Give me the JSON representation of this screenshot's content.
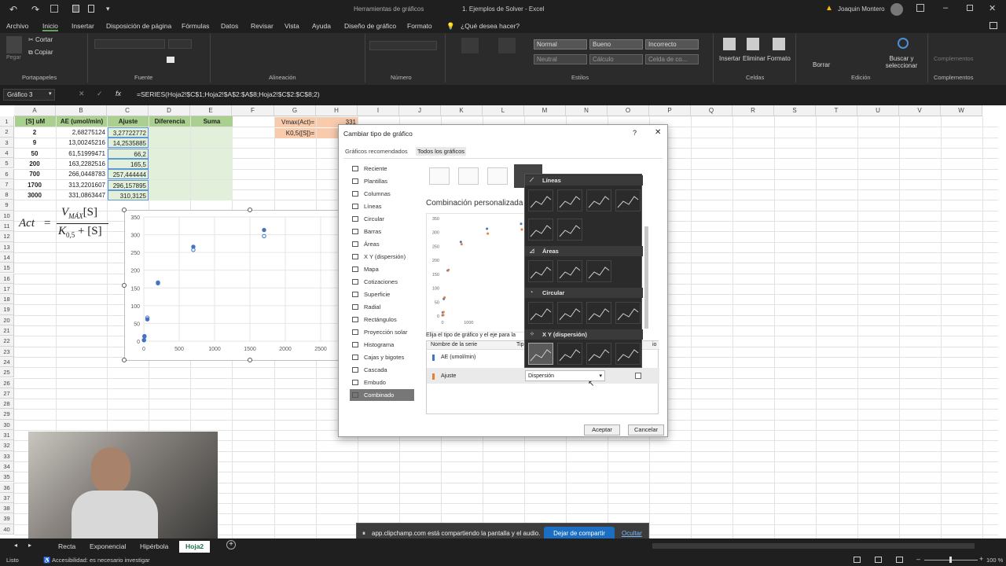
{
  "titlebar": {
    "center_left": "Herramientas de gráficos",
    "doc_title": "1. Ejemplos de Solver  -  Excel",
    "user": "Joaquin Montero"
  },
  "menu": [
    "Archivo",
    "Inicio",
    "Insertar",
    "Disposición de página",
    "Fórmulas",
    "Datos",
    "Revisar",
    "Vista",
    "Ayuda",
    "Diseño de gráfico",
    "Formato"
  ],
  "tell_me": "¿Qué desea hacer?",
  "ribbon": {
    "clipboard": {
      "cut": "Cortar",
      "copy": "Copiar",
      "paste": "Pegar",
      "label": "Portapapeles"
    },
    "font_label": "Fuente",
    "align_label": "Alineación",
    "number_label": "Número",
    "styles_label": "Estilos",
    "cells_label": "Celdas",
    "edit_label": "Edición",
    "addins_label": "Complementos",
    "styles": [
      "Normal",
      "Bueno",
      "Incorrecto",
      "Neutral",
      "Cálculo",
      "Celda de co..."
    ],
    "cells": [
      "Insertar",
      "Eliminar",
      "Formato"
    ],
    "borrar": "Borrar",
    "find": "Buscar y seleccionar",
    "complementos": "Complementos"
  },
  "formula": {
    "namebox": "Gráfico 3",
    "fx": "fx",
    "text": "=SERIES(Hoja2!$C$1;Hoja2!$A$2:$A$8;Hoja2!$C$2:$C$8;2)"
  },
  "columns": [
    "A",
    "B",
    "C",
    "D",
    "E",
    "F",
    "G",
    "H",
    "I",
    "J",
    "K",
    "L",
    "M",
    "N",
    "O",
    "P",
    "Q",
    "R",
    "S",
    "T",
    "U",
    "V",
    "W"
  ],
  "rows": [
    "1",
    "2",
    "3",
    "4",
    "5",
    "6",
    "7",
    "8",
    "9",
    "10",
    "11",
    "12",
    "13",
    "14",
    "15",
    "16",
    "17",
    "18",
    "19",
    "20",
    "21",
    "22",
    "23",
    "24",
    "25",
    "26",
    "27",
    "28",
    "29",
    "30",
    "31",
    "32",
    "33",
    "34",
    "35",
    "36",
    "37",
    "38",
    "39",
    "40"
  ],
  "table": {
    "headers": [
      "[S] uM",
      "AE (umol/min)",
      "Ajuste",
      "Diferencia",
      "Suma"
    ],
    "rows": [
      [
        "2",
        "2,68275124",
        "3,27722772"
      ],
      [
        "9",
        "13,00245216",
        "14,2535885"
      ],
      [
        "50",
        "61,51999471",
        "66,2"
      ],
      [
        "200",
        "163,2282516",
        "165,5"
      ],
      [
        "700",
        "266,0448783",
        "257,444444"
      ],
      [
        "1700",
        "313,2201607",
        "296,157895"
      ],
      [
        "3000",
        "331,0863447",
        "310,3125"
      ]
    ],
    "vmax_label": "Vmax(Act)=",
    "vmax_value": "331",
    "k_label": "K0,5([S])="
  },
  "equation": {
    "lhs": "Act",
    "eq": "=",
    "num": "V",
    "num_sub": "MÁX",
    "num_s": "[S]",
    "den": "K",
    "den_sub": "0,5",
    "den_plus": "+ [S]"
  },
  "chart_data": {
    "type": "scatter",
    "x_ticks": [
      "0",
      "500",
      "1000",
      "1500",
      "2000",
      "2500",
      "3000"
    ],
    "y_ticks": [
      "0",
      "50",
      "100",
      "150",
      "200",
      "250",
      "300",
      "350"
    ],
    "xlim": [
      0,
      3000
    ],
    "ylim": [
      0,
      350
    ],
    "series": [
      {
        "values_x": [
          2,
          9,
          50,
          200,
          700,
          1700,
          3000
        ],
        "values_y": [
          2.68,
          13.0,
          61.52,
          163.23,
          266.04,
          313.22,
          331.09
        ]
      },
      {
        "values_x": [
          2,
          9,
          50,
          200,
          700,
          1700,
          3000
        ],
        "values_y": [
          3.28,
          14.25,
          66.2,
          165.5,
          257.44,
          296.16,
          310.31
        ]
      }
    ],
    "colors": [
      "#4472c4",
      "#4472c4"
    ]
  },
  "dialog": {
    "title": "Cambiar tipo de gráfico",
    "help": "?",
    "close": "✕",
    "tabs": [
      "Gráficos recomendados",
      "Todos los gráficos"
    ],
    "types": [
      "Reciente",
      "Plantillas",
      "Columnas",
      "Líneas",
      "Circular",
      "Barras",
      "Áreas",
      "X Y (dispersión)",
      "Mapa",
      "Cotizaciones",
      "Superficie",
      "Radial",
      "Rectángulos",
      "Proyección solar",
      "Histograma",
      "Cajas y bigotes",
      "Cascada",
      "Embudo",
      "Combinado"
    ],
    "combo_title": "Combinación personalizada",
    "preview_y": [
      "350",
      "300",
      "250",
      "200",
      "150",
      "100",
      "50",
      "0"
    ],
    "preview_x": [
      "0",
      "1000"
    ],
    "instr": "Elija el tipo de gráfico y el eje para la",
    "series_header": "Nombre de la serie",
    "type_header": "Tip",
    "axis_header": "io",
    "series": [
      {
        "name": "AE (umol/min)",
        "color": "#4472c4"
      },
      {
        "name": "Ajuste",
        "color": "#ed7d31",
        "type": "Dispersión"
      }
    ],
    "ok": "Aceptar",
    "cancel": "Cancelar"
  },
  "popup": {
    "sections": [
      "Líneas",
      "Áreas",
      "Circular",
      "X Y (dispersión)"
    ]
  },
  "share": {
    "text": "app.clipchamp.com está compartiendo la pantalla y el audio.",
    "stop": "Dejar de compartir",
    "hide": "Ocultar"
  },
  "sheettabs": [
    "Recta",
    "Exponencial",
    "Hipérbola",
    "Hoja2"
  ],
  "status": {
    "ready": "Listo",
    "access": "Accesibilidad: es necesario investigar",
    "zoom": "100 %"
  }
}
